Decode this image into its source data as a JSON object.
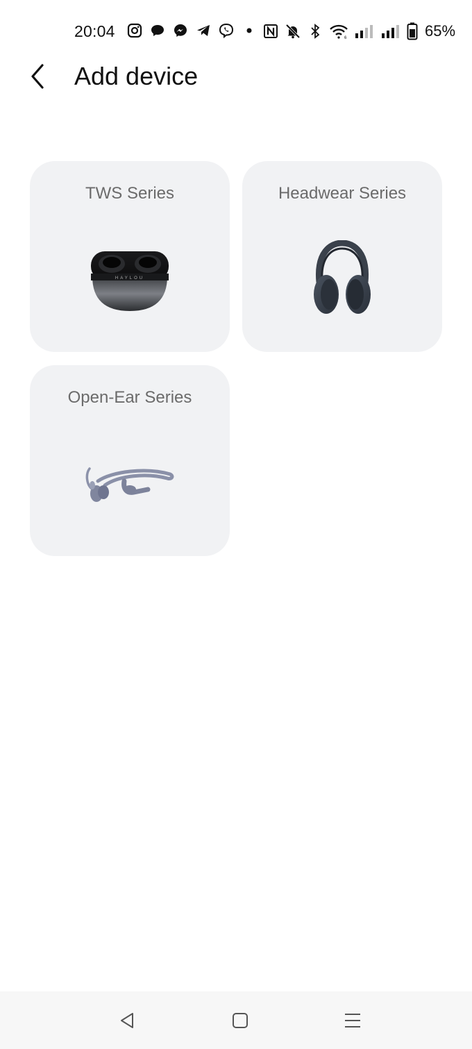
{
  "status_bar": {
    "time": "20:04",
    "battery_percent": "65%",
    "left_icons": [
      "instagram-icon",
      "chat-bubble-icon",
      "messenger-icon",
      "telegram-icon",
      "viber-icon",
      "dot-icon"
    ],
    "right_icons": [
      "nfc-icon",
      "mute-bell-icon",
      "bluetooth-icon",
      "wifi-icon",
      "signal-weak-icon",
      "signal-icon",
      "battery-icon"
    ]
  },
  "header": {
    "title": "Add device",
    "back_icon": "chevron-left-icon"
  },
  "cards": [
    {
      "label": "TWS Series",
      "image": "earbuds-case-image"
    },
    {
      "label": "Headwear Series",
      "image": "headphones-image"
    },
    {
      "label": "Open-Ear Series",
      "image": "open-ear-headset-image"
    }
  ],
  "tws_case_brand": "HAYLOU",
  "nav_bar": {
    "buttons": [
      "back-triangle-icon",
      "home-square-icon",
      "menu-lines-icon"
    ]
  },
  "colors": {
    "card_bg": "#f1f2f4",
    "card_label": "#6b6b6b",
    "title": "#111111",
    "nav_bg": "#f7f7f7"
  }
}
